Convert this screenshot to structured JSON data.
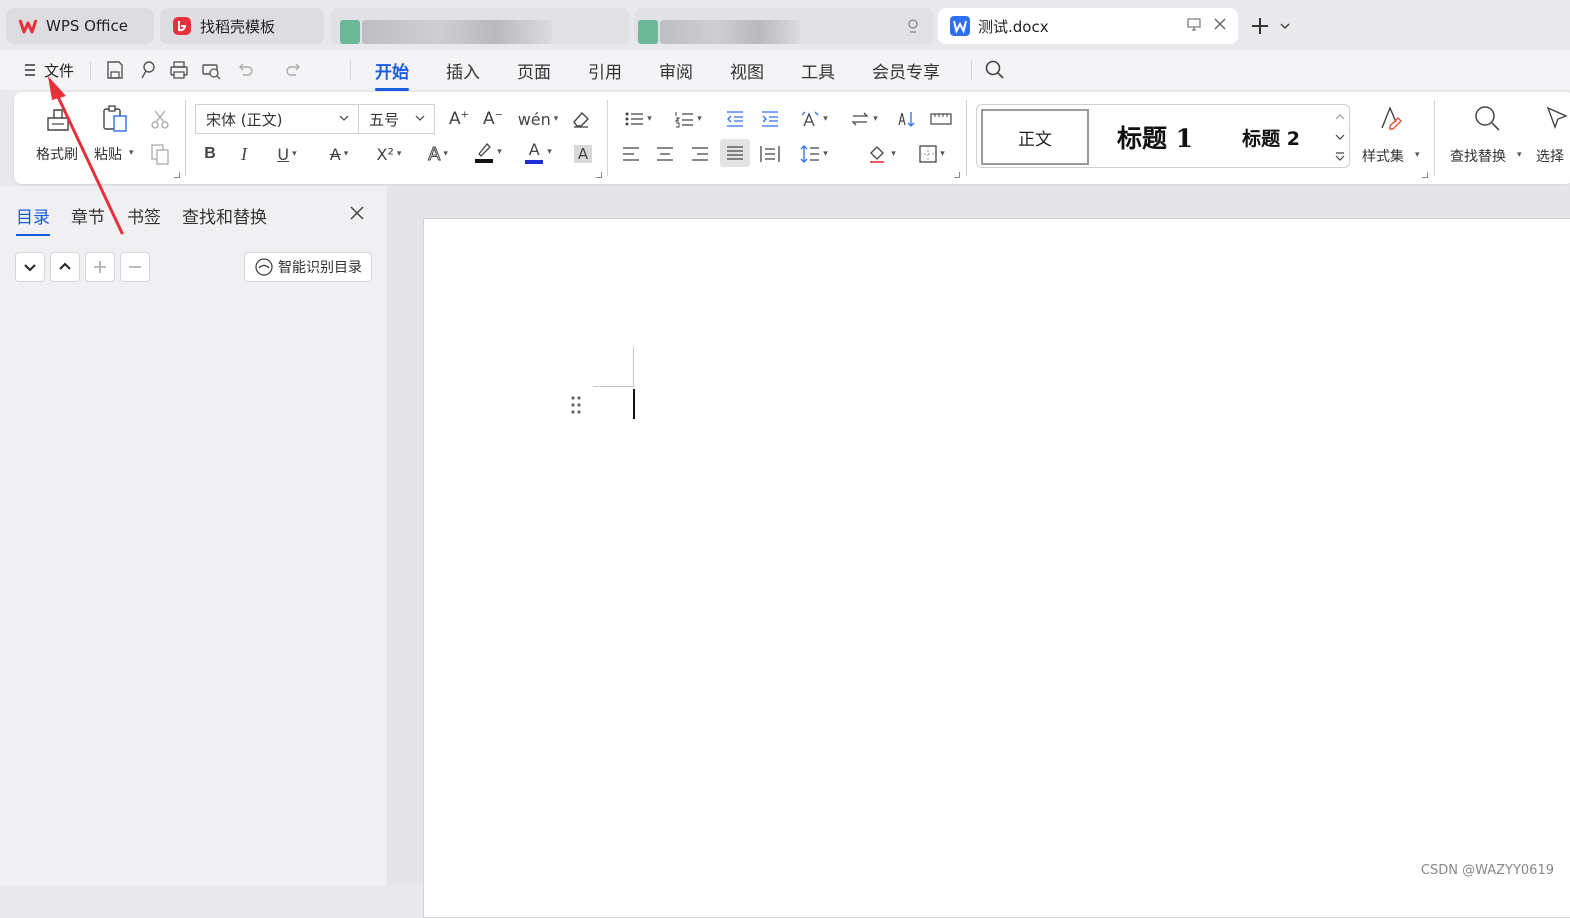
{
  "tabs": [
    {
      "label": "WPS Office",
      "icon": "wps-logo-icon"
    },
    {
      "label": "找稻壳模板",
      "icon": "docer-icon"
    },
    {
      "label": "",
      "icon": "blurred"
    },
    {
      "label": "",
      "icon": "blurred"
    },
    {
      "label": "测试.docx",
      "icon": "word-doc-icon",
      "active": true
    }
  ],
  "menu": {
    "file_label": "文件",
    "tabs": [
      "开始",
      "插入",
      "页面",
      "引用",
      "审阅",
      "视图",
      "工具",
      "会员专享"
    ],
    "active_tab": "开始"
  },
  "ribbon": {
    "format_painter": "格式刷",
    "paste": "粘贴",
    "font_name": "宋体 (正文)",
    "font_size": "五号",
    "styles": [
      "正文",
      "标题 1",
      "标题 2"
    ],
    "style_set": "样式集",
    "find_replace": "查找替换",
    "select": "选择",
    "bold": "B",
    "italic": "I",
    "underline": "U",
    "superscript": "X²",
    "font_color_letter": "A",
    "char_shading_letter": "A"
  },
  "left_panel": {
    "tabs": [
      "目录",
      "章节",
      "书签",
      "查找和替换"
    ],
    "active_tab": "目录",
    "smart_toc": "智能识别目录"
  },
  "watermark": "CSDN @WAZYY0619",
  "colors": {
    "accent": "#1a5ce0",
    "wps_red": "#e8303a",
    "highlight_bar": "#111111",
    "font_color_bar": "#1f2fd6",
    "arrow_red": "#e8303a"
  }
}
